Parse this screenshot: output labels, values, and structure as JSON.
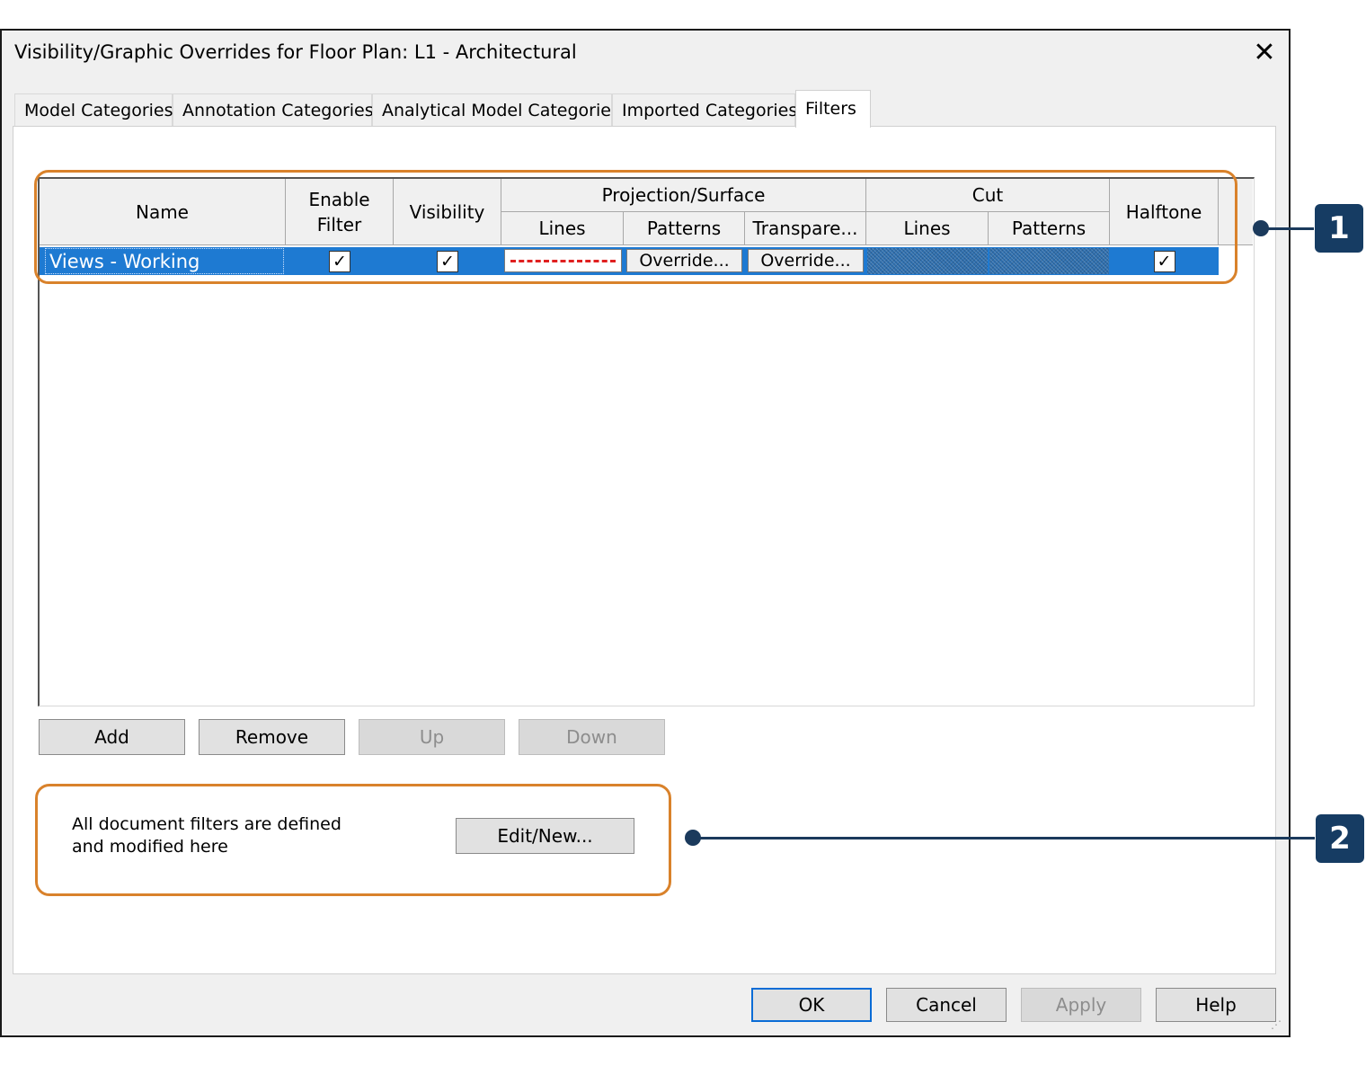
{
  "dialog": {
    "title": "Visibility/Graphic Overrides for Floor Plan: L1 - Architectural",
    "close_glyph": "✕"
  },
  "tabs": [
    {
      "label": "Model Categories"
    },
    {
      "label": "Annotation Categories"
    },
    {
      "label": "Analytical Model Categories"
    },
    {
      "label": "Imported Categories"
    },
    {
      "label": "Filters",
      "active": true
    }
  ],
  "grid": {
    "headers": {
      "name": "Name",
      "enable_filter": "Enable\nFilter",
      "visibility": "Visibility",
      "projection_surface": "Projection/Surface",
      "proj_lines": "Lines",
      "proj_patterns": "Patterns",
      "proj_transparency": "Transpare...",
      "cut": "Cut",
      "cut_lines": "Lines",
      "cut_patterns": "Patterns",
      "halftone": "Halftone"
    },
    "rows": [
      {
        "name": "Views - Working",
        "enable_filter": true,
        "visibility": true,
        "projection_lines_color": "#e02020",
        "projection_patterns": "Override...",
        "projection_transparency": "Override...",
        "halftone": true
      }
    ],
    "check_glyph": "✓",
    "selected_row_color": "#1e7ad2"
  },
  "row_buttons": {
    "add": "Add",
    "remove": "Remove",
    "up": "Up",
    "down": "Down"
  },
  "filters_note": {
    "text": "All document filters are defined and modified here",
    "edit_new": "Edit/New..."
  },
  "footer_buttons": {
    "ok": "OK",
    "cancel": "Cancel",
    "apply": "Apply",
    "help": "Help"
  },
  "callouts": [
    {
      "number": "1"
    },
    {
      "number": "2"
    }
  ],
  "colors": {
    "callout_outline": "#d9822b",
    "callout_badge": "#163c63"
  }
}
